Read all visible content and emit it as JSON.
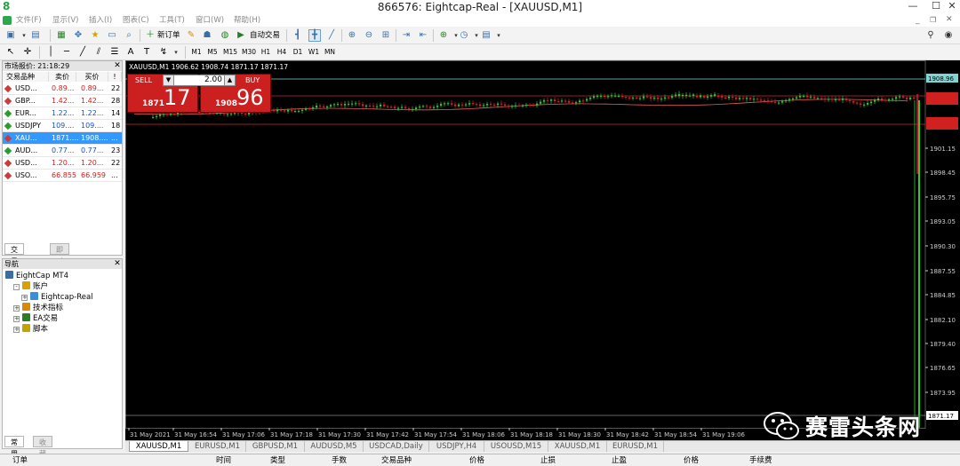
{
  "window": {
    "title": "866576: Eightcap-Real - [XAUUSD,M1]",
    "logo": "8",
    "controls": {
      "minimize": "—",
      "maximize": "☐",
      "close": "✕"
    }
  },
  "menu": [
    "文件(F)",
    "显示(V)",
    "插入(I)",
    "图表(C)",
    "工具(T)",
    "窗口(W)",
    "帮助(H)"
  ],
  "toolbar": {
    "new_order": "新订单",
    "auto_trading": "自动交易",
    "periods": [
      "M1",
      "M5",
      "M15",
      "M30",
      "H1",
      "H4",
      "D1",
      "W1",
      "MN"
    ]
  },
  "market_watch": {
    "title": "市场报价: 21:18:29",
    "columns": [
      "交易品种",
      "卖价",
      "买价",
      "!"
    ],
    "rows": [
      {
        "symbol": "USD...",
        "bid": "0.89...",
        "ask": "0.89...",
        "spread": "22",
        "dir": "down",
        "selected": false
      },
      {
        "symbol": "GBP...",
        "bid": "1.42...",
        "ask": "1.42...",
        "spread": "28",
        "dir": "down",
        "selected": false
      },
      {
        "symbol": "EUR...",
        "bid": "1.22...",
        "ask": "1.22...",
        "spread": "14",
        "dir": "up",
        "selected": false
      },
      {
        "symbol": "USDJPY",
        "bid": "109....",
        "ask": "109....",
        "spread": "18",
        "dir": "up",
        "selected": false
      },
      {
        "symbol": "XAU...",
        "bid": "1871....",
        "ask": "1908....",
        "spread": "...",
        "dir": "down",
        "selected": true
      },
      {
        "symbol": "AUD...",
        "bid": "0.77...",
        "ask": "0.77...",
        "spread": "23",
        "dir": "up",
        "selected": false
      },
      {
        "symbol": "USD...",
        "bid": "1.20...",
        "ask": "1.20...",
        "spread": "22",
        "dir": "down",
        "selected": false
      },
      {
        "symbol": "USO...",
        "bid": "66.855",
        "ask": "66.959",
        "spread": "...",
        "dir": "down",
        "selected": false
      }
    ],
    "tabs": [
      "交易品种",
      "即时图"
    ]
  },
  "navigator": {
    "title": "导航",
    "items": [
      {
        "label": "EightCap MT4",
        "level": 0,
        "expander": ""
      },
      {
        "label": "账户",
        "level": 1,
        "expander": "-"
      },
      {
        "label": "Eightcap-Real",
        "level": 2,
        "expander": "+"
      },
      {
        "label": "技术指标",
        "level": 1,
        "expander": "+"
      },
      {
        "label": "EA交易",
        "level": 1,
        "expander": "+"
      },
      {
        "label": "脚本",
        "level": 1,
        "expander": "+"
      }
    ],
    "tabs": [
      "常用",
      "收藏夹"
    ]
  },
  "chart": {
    "header": "XAUUSD,M1  1906.62 1908.74 1871.17 1871.17",
    "sell_label": "SELL",
    "buy_label": "BUY",
    "lot": "2.00",
    "sell_small": "1871",
    "sell_big": "17",
    "buy_small": "1908",
    "buy_big": "96",
    "price_axis": [
      "1901.15",
      "1898.45",
      "1895.75",
      "1893.05",
      "1890.30",
      "1887.55",
      "1884.85",
      "1882.10",
      "1879.40",
      "1876.65",
      "1873.95"
    ],
    "price_tags": [
      "1908.96",
      "1871.17"
    ],
    "time_axis": [
      "31 May 2021",
      "31 May 16:54",
      "31 May 17:06",
      "31 May 17:18",
      "31 May 17:30",
      "31 May 17:42",
      "31 May 17:54",
      "31 May 18:06",
      "31 May 18:18",
      "31 May 18:30",
      "31 May 18:42",
      "31 May 18:54",
      "31 May 19:06"
    ]
  },
  "chart_tabs": [
    "XAUUSD,M1",
    "EURUSD,M1",
    "GBPUSD,M1",
    "AUDUSD,M5",
    "USDCAD,Daily",
    "USDJPY,H4",
    "USOUSD,M15",
    "XAUUSD,M1",
    "EURUSD,M1"
  ],
  "terminal_columns": [
    "订单",
    "时间",
    "类型",
    "手数",
    "交易品种",
    "价格",
    "止损",
    "止盈",
    "价格",
    "手续费"
  ],
  "watermark": "赛雷头条网",
  "colors": {
    "bull": "#2bd12b",
    "bear": "#e02020",
    "sell_button": "#cc1f1f",
    "selected_row": "#3399ff",
    "volume_line": "#2bd12b"
  }
}
